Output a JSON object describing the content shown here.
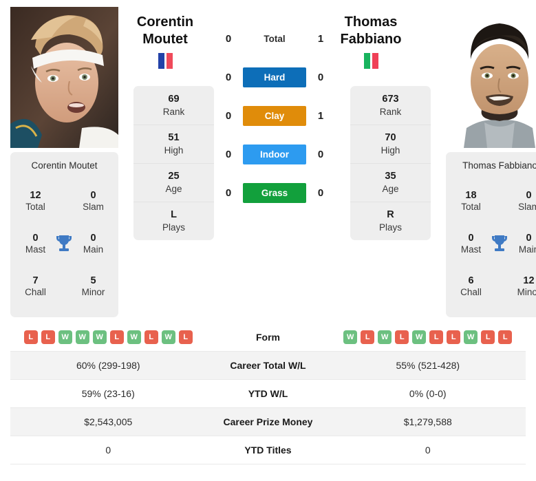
{
  "players": {
    "left": {
      "first_name": "Corentin",
      "last_name": "Moutet",
      "full_name": "Corentin Moutet",
      "photo_name": "corentin-moutet-photo",
      "country": "France",
      "flag_colors": [
        "#2342a8",
        "#f04a5a"
      ],
      "stats": [
        {
          "value": "69",
          "label": "Rank"
        },
        {
          "value": "51",
          "label": "High"
        },
        {
          "value": "25",
          "label": "Age"
        },
        {
          "value": "L",
          "label": "Plays"
        }
      ],
      "titles": [
        {
          "value": "12",
          "label": "Total"
        },
        {
          "value": "0",
          "label": "Slam"
        },
        {
          "value": "0",
          "label": "Mast"
        },
        {
          "value": "0",
          "label": "Main"
        },
        {
          "value": "7",
          "label": "Chall"
        },
        {
          "value": "5",
          "label": "Minor"
        }
      ],
      "form": [
        "L",
        "L",
        "W",
        "W",
        "W",
        "L",
        "W",
        "L",
        "W",
        "L"
      ]
    },
    "right": {
      "first_name": "Thomas",
      "last_name": "Fabbiano",
      "full_name": "Thomas Fabbiano",
      "photo_name": "thomas-fabbiano-photo",
      "country": "Italy",
      "flag_colors": [
        "#18b35e",
        "#ef4056"
      ],
      "stats": [
        {
          "value": "673",
          "label": "Rank"
        },
        {
          "value": "70",
          "label": "High"
        },
        {
          "value": "35",
          "label": "Age"
        },
        {
          "value": "R",
          "label": "Plays"
        }
      ],
      "titles": [
        {
          "value": "18",
          "label": "Total"
        },
        {
          "value": "0",
          "label": "Slam"
        },
        {
          "value": "0",
          "label": "Mast"
        },
        {
          "value": "0",
          "label": "Main"
        },
        {
          "value": "6",
          "label": "Chall"
        },
        {
          "value": "12",
          "label": "Minor"
        }
      ],
      "form": [
        "W",
        "L",
        "W",
        "L",
        "W",
        "L",
        "L",
        "W",
        "L",
        "L"
      ]
    }
  },
  "trophy_icon": "trophy-icon",
  "trophy_color": "#3f7ac4",
  "h2h": [
    {
      "label": "Total",
      "left": "0",
      "right": "1",
      "color": null,
      "badge": false
    },
    {
      "label": "Hard",
      "left": "0",
      "right": "0",
      "color": "#0d6eb8",
      "badge": true
    },
    {
      "label": "Clay",
      "left": "0",
      "right": "1",
      "color": "#e08c0a",
      "badge": true
    },
    {
      "label": "Indoor",
      "left": "0",
      "right": "0",
      "color": "#2d9bf0",
      "badge": true
    },
    {
      "label": "Grass",
      "left": "0",
      "right": "0",
      "color": "#12a03c",
      "badge": true
    }
  ],
  "table": {
    "form_label": "Form",
    "rows": [
      {
        "label": "Career Total W/L",
        "left": "60% (299-198)",
        "right": "55% (521-428)"
      },
      {
        "label": "YTD W/L",
        "left": "59% (23-16)",
        "right": "0% (0-0)"
      },
      {
        "label": "Career Prize Money",
        "left": "$2,543,005",
        "right": "$1,279,588"
      },
      {
        "label": "YTD Titles",
        "left": "0",
        "right": "0"
      }
    ]
  }
}
